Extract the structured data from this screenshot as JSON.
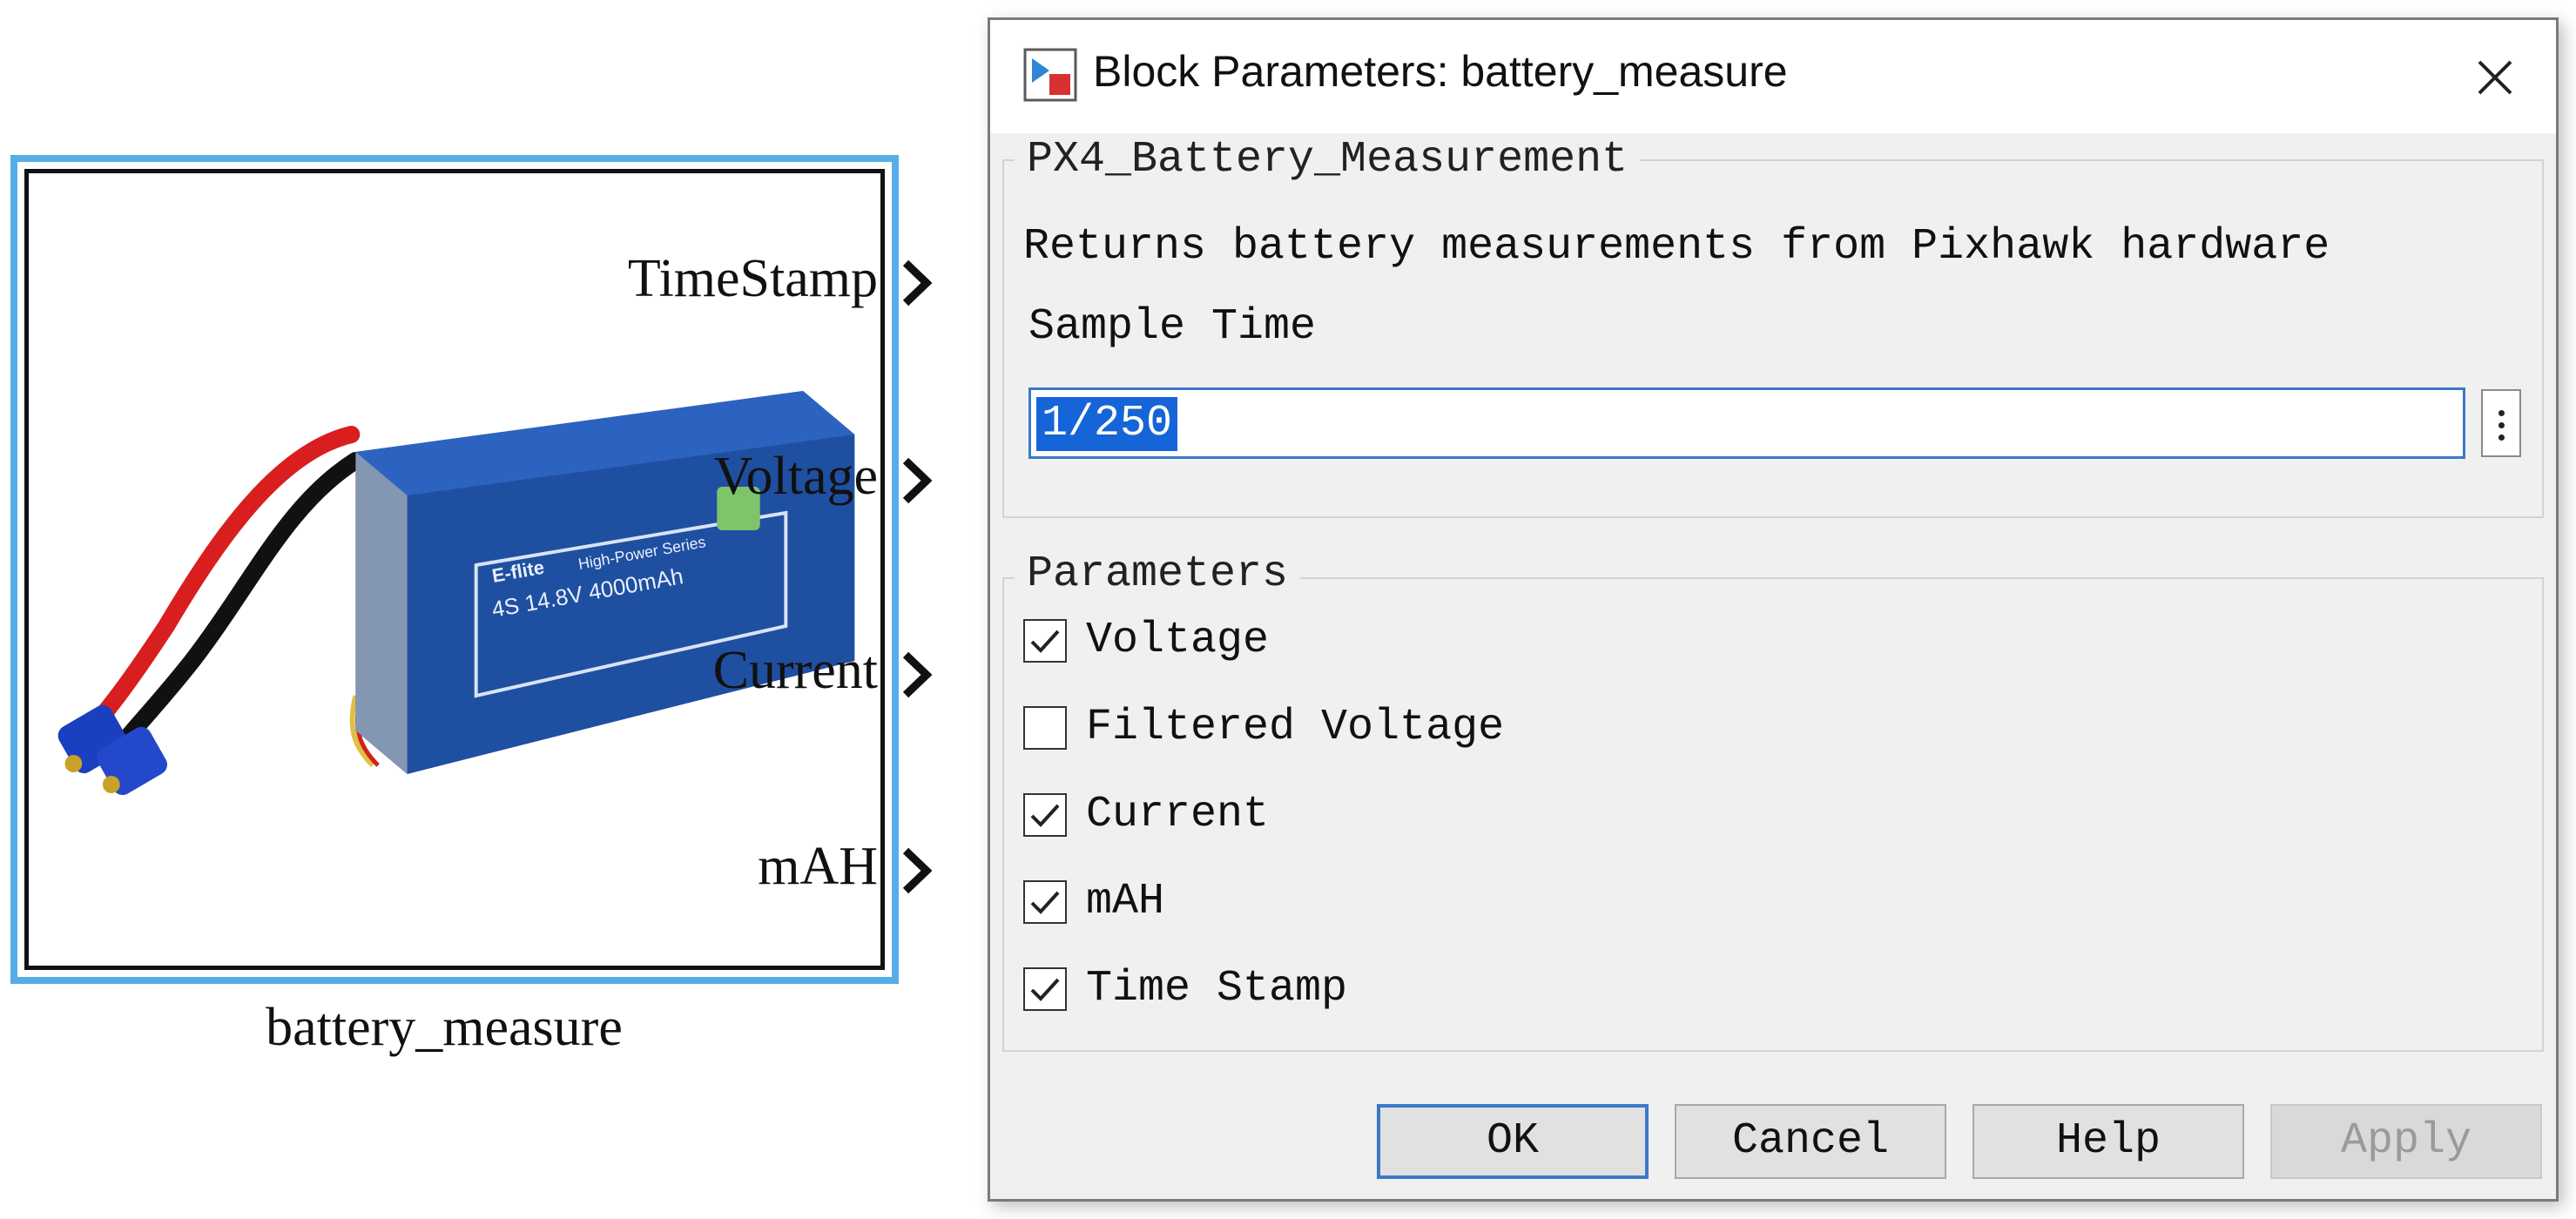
{
  "block": {
    "name": "battery_measure",
    "ports": [
      "TimeStamp",
      "Voltage",
      "Current",
      "mAH"
    ],
    "image": {
      "name": "lipo-battery-image",
      "label_text": "4S 14.8V 4000mAh",
      "brand": "E-flite",
      "series": "High-Power Series"
    },
    "colors": {
      "selection_border": "#55aee8",
      "battery_body": "#1f4fa0",
      "wire_red": "#d81e1e",
      "wire_black": "#111111",
      "connector": "#1a3fbf"
    }
  },
  "dialog": {
    "title": "Block Parameters: battery_measure",
    "close_icon": "close-icon",
    "main_group": {
      "legend": "PX4_Battery_Measurement",
      "description": "Returns battery measurements from Pixhawk hardware",
      "sample_time_label": "Sample Time",
      "sample_time_value": "1/250"
    },
    "parameters_group": {
      "legend": "Parameters",
      "items": [
        {
          "label": "Voltage",
          "checked": true
        },
        {
          "label": "Filtered Voltage",
          "checked": false
        },
        {
          "label": "Current",
          "checked": true
        },
        {
          "label": "mAH",
          "checked": true
        },
        {
          "label": "Time Stamp",
          "checked": true
        }
      ]
    },
    "buttons": {
      "ok": "OK",
      "cancel": "Cancel",
      "help": "Help",
      "apply": "Apply"
    },
    "colors": {
      "accent": "#3b78c8",
      "selection": "#1565d8",
      "background": "#f0f0f0"
    }
  }
}
